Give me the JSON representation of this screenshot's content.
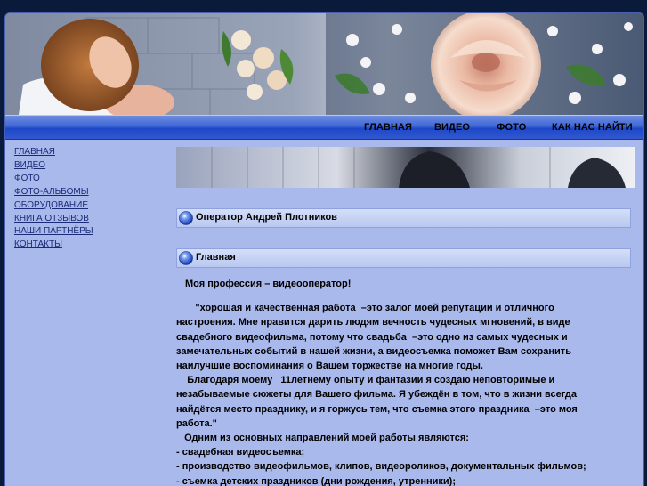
{
  "nav": {
    "items": [
      {
        "label": "ГЛАВНАЯ"
      },
      {
        "label": "ВИДЕО"
      },
      {
        "label": "ФОТО"
      },
      {
        "label": "КАК НАС НАЙТИ"
      }
    ]
  },
  "sidebar": {
    "links": [
      {
        "label": "ГЛАВНАЯ"
      },
      {
        "label": "ВИДЕО"
      },
      {
        "label": "ФОТО"
      },
      {
        "label": "ФОТО-АЛЬБОМЫ"
      },
      {
        "label": "ОБОРУДОВАНИЕ"
      },
      {
        "label": "КНИГА ОТЗЫВОВ"
      },
      {
        "label": "НАШИ ПАРТНЁРЫ"
      },
      {
        "label": "КОНТАКТЫ"
      }
    ]
  },
  "panels": {
    "operator_title": "Оператор Андрей Плотников",
    "main_title": "Главная"
  },
  "content": {
    "profession": "Моя профессия – видеооператор!",
    "lines": [
      "       \"хорошая и качественная работа  –это залог моей репутации и отличного",
      "настроения. Мне нравится дарить людям вечность чудесных мгновений, в виде",
      "свадебного видеофильма, потому что свадьба  –это одно из самых чудесных и",
      "замечательных событий в нашей жизни, а видеосъемка поможет Вам сохранить",
      "наилучшие воспоминания о Вашем торжестве на многие годы.",
      "    Благодаря моему   11летнему опыту и фантазии я создаю неповторимые и",
      "незабываемые сюжеты для Вашего фильма. Я убеждён в том, что в жизни всегда",
      "найдётся место празднику, и я горжусь тем, что съемка этого праздника  –это моя",
      "работа.\"",
      "   Одним из основных направлений моей работы являются:",
      "- свадебная видеосъемка;",
      "- производство видеофильмов, клипов, видеороликов, документальных фильмов;",
      "- съемка детских праздников (дни рождения, утренники);"
    ]
  },
  "colors": {
    "page_bg": "#0a1a3a",
    "frame_bg": "#a9b9eb",
    "nav_blue": "#1d48c9",
    "link": "#1b2b78"
  }
}
